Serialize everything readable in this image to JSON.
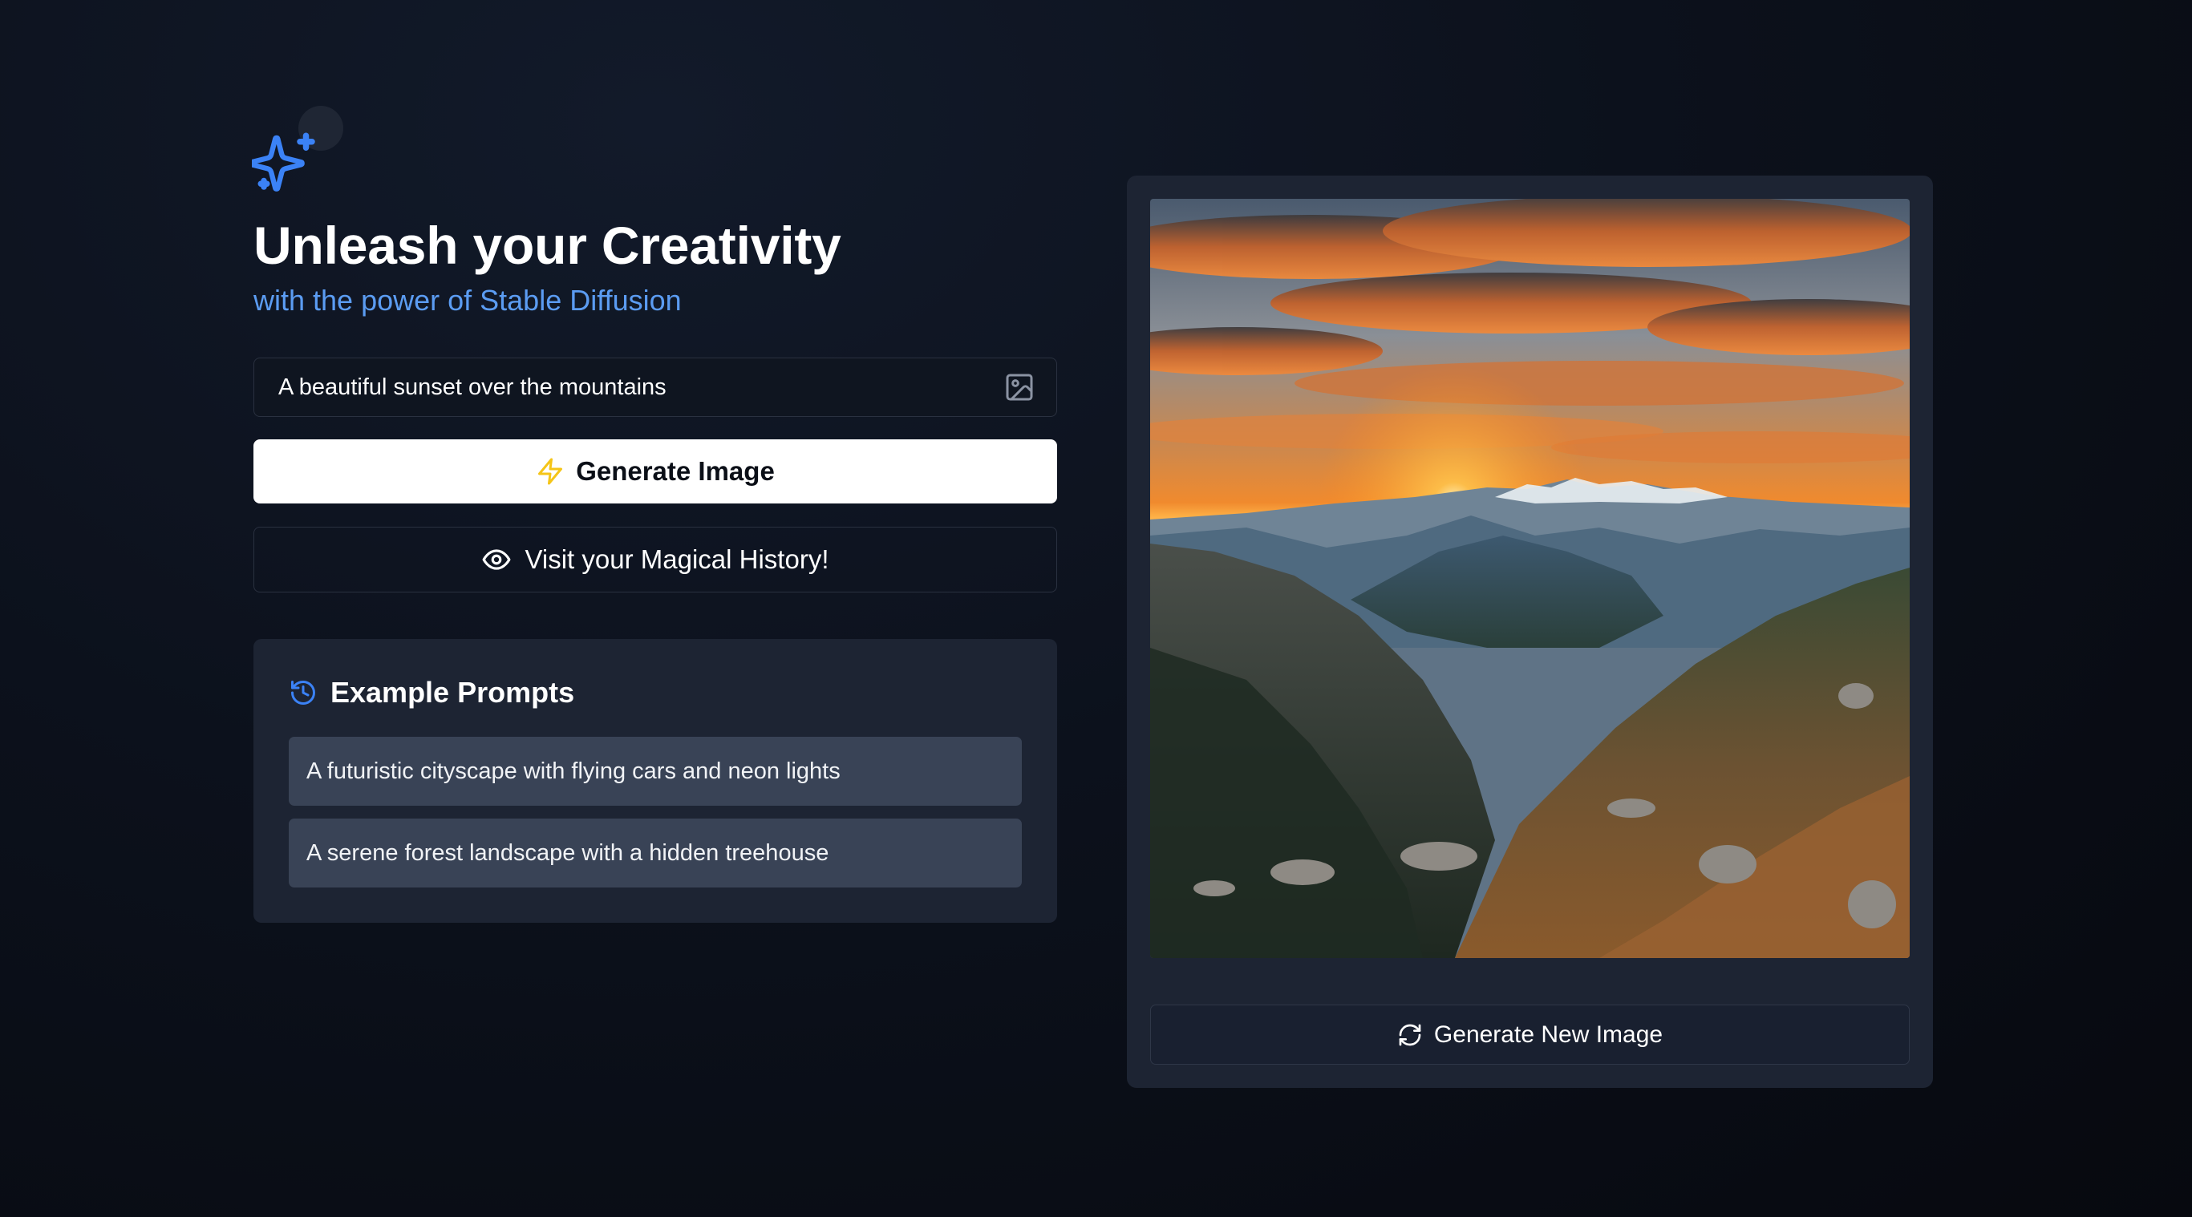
{
  "hero": {
    "logo_icon": "sparkles-icon",
    "title": "Unleash your Creativity",
    "subtitle": "with the power of Stable Diffusion",
    "accent_color": "#5b9cf2"
  },
  "prompt": {
    "value": "A beautiful sunset over the mountains",
    "icon": "image-icon"
  },
  "actions": {
    "generate_label": "Generate Image",
    "generate_icon": "lightning-icon",
    "history_label": "Visit your Magical History!",
    "history_icon": "eye-icon"
  },
  "examples": {
    "heading": "Example Prompts",
    "heading_icon": "history-icon",
    "items": [
      {
        "label": "A futuristic cityscape with flying cars and neon lights"
      },
      {
        "label": "A serene forest landscape with a hidden treehouse"
      }
    ]
  },
  "result": {
    "image_alt": "Generated image: sunset over mountain valley",
    "regenerate_label": "Generate New Image",
    "regenerate_icon": "refresh-icon"
  }
}
